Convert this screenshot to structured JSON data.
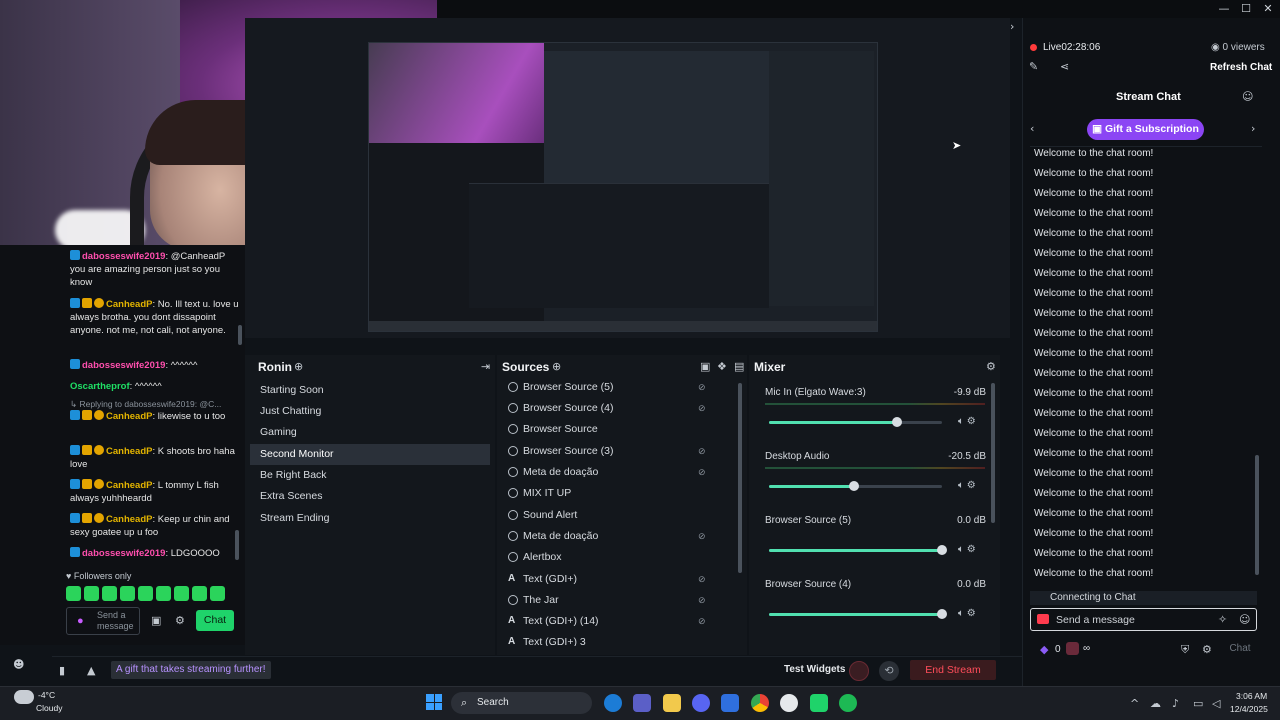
{
  "webcam": {},
  "left_chat": {
    "messages": [
      {
        "user": "dabosseswife2019",
        "text": ": @CanheadP you are amazing person just so you know"
      },
      {
        "user": "CanheadP",
        "text": ": No. Ill text u. love u always brotha. you dont dissapoint anyone. not me, not cali, not anyone."
      },
      {
        "user": "dabosseswife2019",
        "text": ": ^^^^^^"
      },
      {
        "user": "Oscartheprof",
        "text": ": ^^^^^^"
      },
      {
        "user": "Replying to dabosseswife2019: @C...",
        "text": ""
      },
      {
        "user": "CanheadP",
        "text": ": likewise to u too"
      },
      {
        "user": "CanheadP",
        "text": ": K shoots bro haha love"
      },
      {
        "user": "CanheadP",
        "text": ": L tommy L fish always yuhhheardd"
      },
      {
        "user": "CanheadP",
        "text": ": Keep ur chin and sexy goatee up u foo"
      },
      {
        "user": "dabosseswife2019",
        "text": ": LDGOOOO"
      }
    ],
    "followers_only": "Followers only",
    "send_placeholder": "Send a message",
    "chat_button": "Chat"
  },
  "scenes": {
    "title": "Ronin",
    "items": [
      "Starting Soon",
      "Just Chatting",
      "Gaming",
      "Second Monitor",
      "Be Right Back",
      "Extra Scenes",
      "Stream Ending"
    ],
    "active_index": 3
  },
  "sources": {
    "title": "Sources",
    "items": [
      "Browser Source (5)",
      "Browser Source (4)",
      "Browser Source",
      "Browser Source (3)",
      "Meta de doação",
      "MIX IT UP",
      "Sound Alert",
      "Meta de doação",
      "Alertbox",
      "Text (GDI+)",
      "The Jar",
      "Text (GDI+) (14)",
      "Text (GDI+) 3"
    ]
  },
  "mixer": {
    "title": "Mixer",
    "channels": [
      {
        "name": "Mic In (Elgato Wave:3)",
        "db": "-9.9 dB",
        "level": 0.74
      },
      {
        "name": "Desktop Audio",
        "db": "-20.5 dB",
        "level": 0.49
      },
      {
        "name": "Browser Source (5)",
        "db": "0.0 dB",
        "level": 1.0
      },
      {
        "name": "Browser Source (4)",
        "db": "0.0 dB",
        "level": 1.0
      }
    ]
  },
  "right_panel": {
    "live_label": "Live",
    "live_time": "02:28:06",
    "viewers": "0 viewers",
    "refresh": "Refresh Chat",
    "title": "Stream Chat",
    "gift_button": "Gift a Subscription",
    "welcome_message": "Welcome to the chat room!",
    "welcome_count": 22,
    "connecting": "Connecting to Chat",
    "send_placeholder": "Send a message",
    "points": "0",
    "points_inf": "∞",
    "chat_button": "Chat"
  },
  "status_bar": {
    "alert_text": "A gift that takes streaming further!",
    "test_widgets": "Test Widgets",
    "end_stream": "End Stream"
  },
  "taskbar": {
    "weather_temp": "-4°C",
    "weather_desc": "Cloudy",
    "search_placeholder": "Search",
    "time": "3:06 AM",
    "date": "12/4/2025"
  },
  "colors": {
    "accent_green": "#1fe065",
    "accent_purple": "#8b45f4",
    "end_red": "#ff4d5a",
    "mixer_teal": "#51e0b0"
  }
}
